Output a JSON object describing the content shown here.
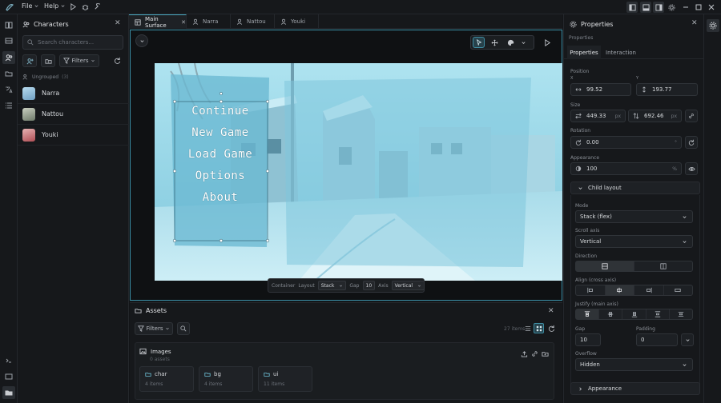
{
  "menu": {
    "file": "File",
    "help": "Help"
  },
  "characters_panel": {
    "title": "Characters",
    "search_placeholder": "Search characters...",
    "filters_label": "Filters",
    "group_label": "Ungrouped",
    "group_count": "(3)",
    "items": [
      {
        "name": "Narra",
        "color": "#7fa9c8"
      },
      {
        "name": "Nattou",
        "color": "#8f9a88"
      },
      {
        "name": "Youki",
        "color": "#c46a6a"
      }
    ]
  },
  "tabs": [
    {
      "label": "Main Surface",
      "active": true,
      "closable": true
    },
    {
      "label": "Narra"
    },
    {
      "label": "Nattou"
    },
    {
      "label": "Youki"
    }
  ],
  "scene": {
    "menu_items": [
      "Continue",
      "New Game",
      "Load Game",
      "Options",
      "About"
    ]
  },
  "canvas_bar": {
    "container_label": "Container",
    "layout_label": "Layout",
    "layout_value": "Stack",
    "gap_label": "Gap",
    "gap_value": "10",
    "axis_label": "Axis",
    "axis_value": "Vertical"
  },
  "assets": {
    "title": "Assets",
    "filters_label": "Filters",
    "item_count": "27 items",
    "group_title": "Images",
    "group_sub": "0 assets",
    "folders": [
      {
        "name": "char",
        "count": "4 items"
      },
      {
        "name": "bg",
        "count": "4 items"
      },
      {
        "name": "ui",
        "count": "11 items"
      }
    ]
  },
  "properties": {
    "title": "Properties",
    "breadcrumb": "Properties",
    "tabs": [
      "Properties",
      "Interaction"
    ],
    "position": {
      "label": "Position",
      "x_label": "X",
      "y_label": "Y",
      "x": "99.52",
      "y": "193.77"
    },
    "size": {
      "label": "Size",
      "w": "449.33",
      "h": "692.46",
      "unit": "px"
    },
    "rotation": {
      "label": "Rotation",
      "value": "0.00",
      "unit": "°"
    },
    "appearance": {
      "label": "Appearance",
      "opacity": "100",
      "unit": "%"
    },
    "child_layout": {
      "title": "Child layout",
      "mode_label": "Mode",
      "mode_value": "Stack (flex)",
      "scroll_label": "Scroll axis",
      "scroll_value": "Vertical",
      "direction_label": "Direction",
      "align_label": "Align (cross axis)",
      "justify_label": "Justify (main axis)",
      "gap_label": "Gap",
      "gap_value": "10",
      "padding_label": "Padding",
      "padding_value": "0",
      "overflow_label": "Overflow",
      "overflow_value": "Hidden"
    },
    "appearance_section": "Appearance"
  },
  "colors": {
    "accent": "#4aa8c0",
    "panel": "#16181b",
    "bg": "#131518"
  }
}
